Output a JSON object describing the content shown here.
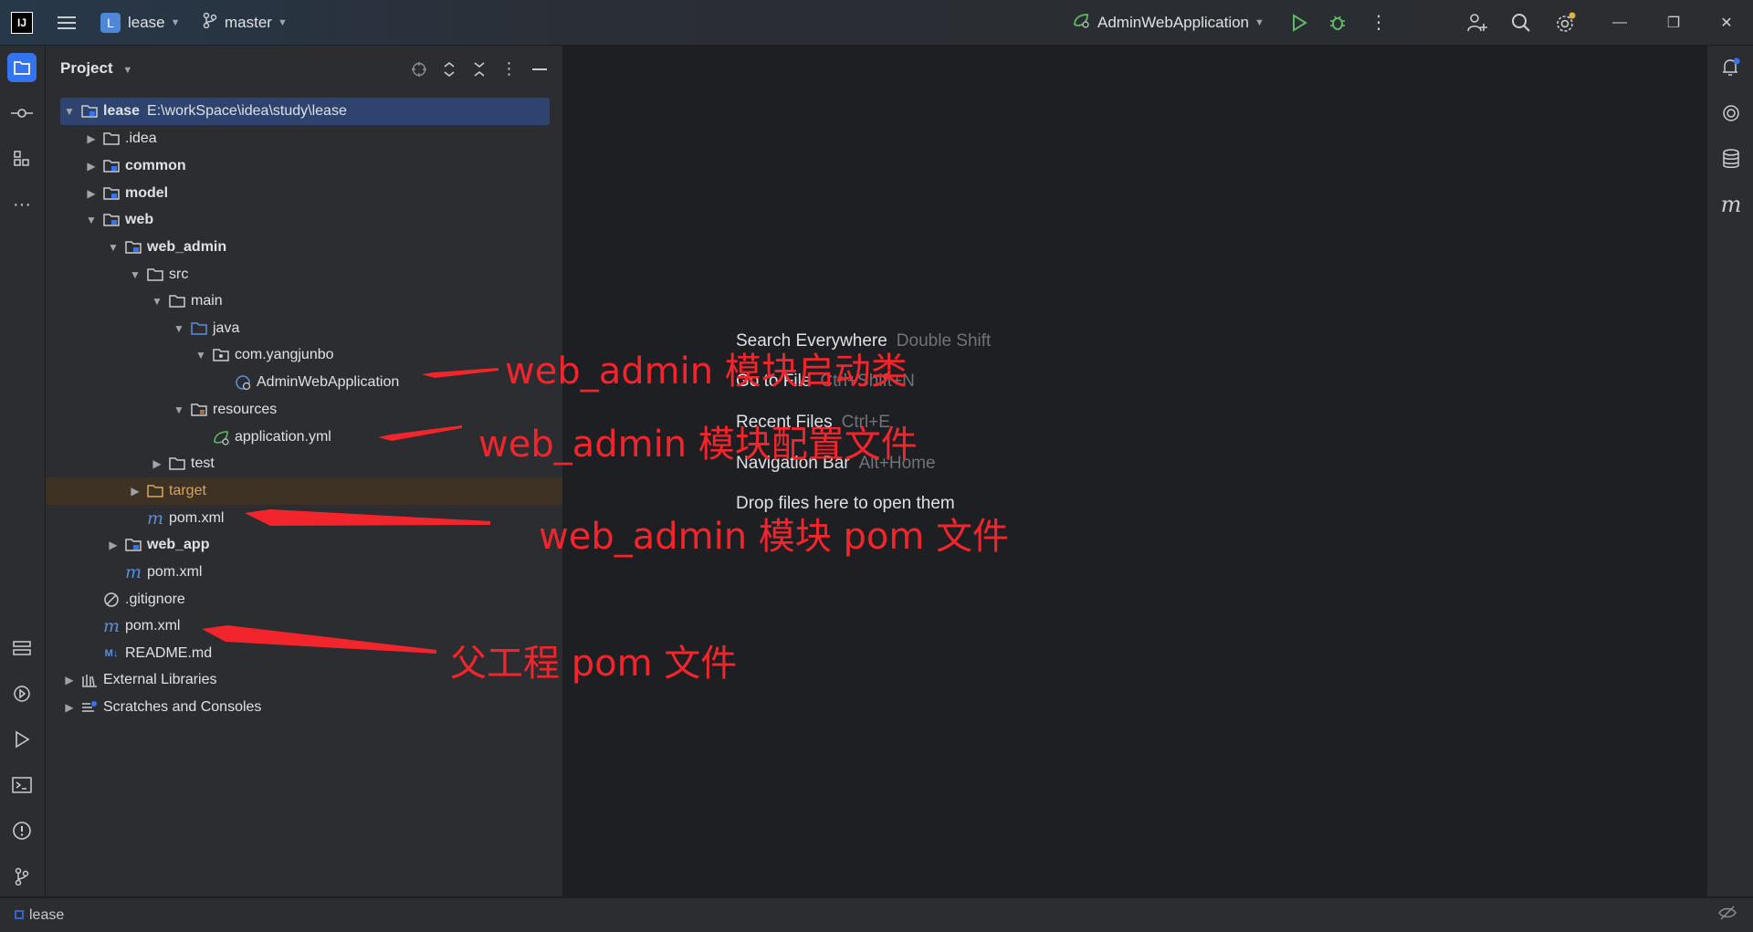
{
  "titlebar": {
    "project_name": "lease",
    "project_initial": "L",
    "branch": "master",
    "run_config": "AdminWebApplication"
  },
  "panel": {
    "title": "Project"
  },
  "tree": {
    "root_name": "lease",
    "root_path": "E:\\workSpace\\idea\\study\\lease",
    "idea": ".idea",
    "common": "common",
    "model": "model",
    "web": "web",
    "web_admin": "web_admin",
    "src": "src",
    "main": "main",
    "java": "java",
    "package": "com.yangjunbo",
    "admin_app": "AdminWebApplication",
    "resources": "resources",
    "app_yml": "application.yml",
    "test": "test",
    "target": "target",
    "admin_pom": "pom.xml",
    "web_app": "web_app",
    "web_pom": "pom.xml",
    "gitignore": ".gitignore",
    "root_pom": "pom.xml",
    "readme": "README.md",
    "external_libraries": "External Libraries",
    "scratches": "Scratches and Consoles"
  },
  "editor_hints": [
    {
      "label": "Search Everywhere",
      "shortcut": "Double Shift"
    },
    {
      "label": "Go to File",
      "shortcut": "Ctrl+Shift+N"
    },
    {
      "label": "Recent Files",
      "shortcut": "Ctrl+E"
    },
    {
      "label": "Navigation Bar",
      "shortcut": "Alt+Home"
    },
    {
      "label": "Drop files here to open them",
      "shortcut": ""
    }
  ],
  "annotations": {
    "startup_class": "web_admin 模块启动类",
    "config_file": "web_admin 模块配置文件",
    "module_pom": "web_admin 模块 pom 文件",
    "parent_pom": "父工程 pom 文件"
  },
  "statusbar": {
    "project": "lease"
  },
  "colors": {
    "accent": "#3574f0",
    "annotation": "#f3252c",
    "selection": "#2e436e",
    "excluded": "#d8a460"
  }
}
